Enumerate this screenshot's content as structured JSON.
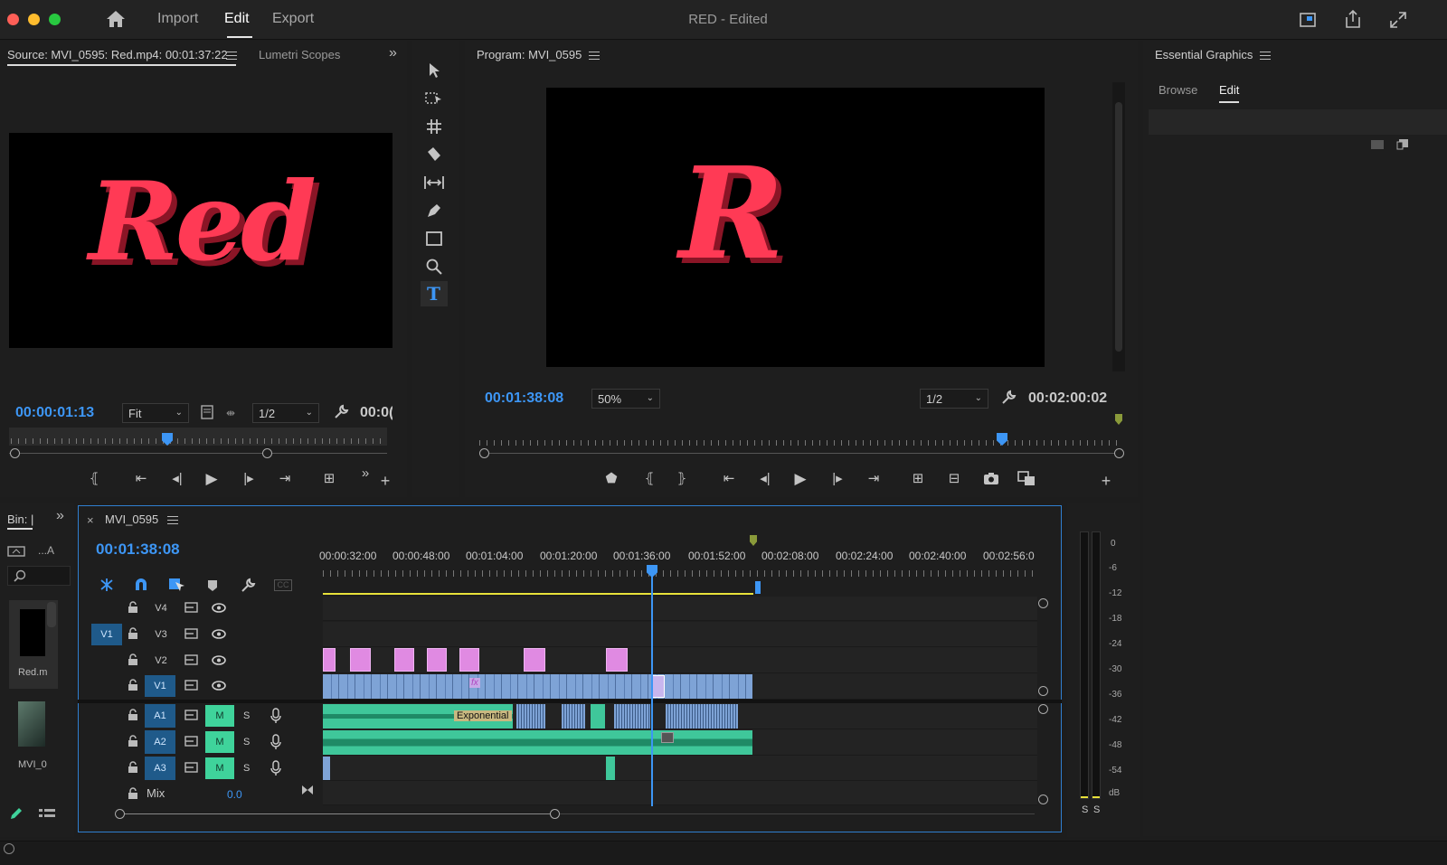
{
  "app": {
    "title": "RED - Edited",
    "workspaces": [
      "Import",
      "Edit",
      "Export"
    ],
    "active_workspace": "Edit"
  },
  "source_panel": {
    "tab_title": "Source: MVI_0595: Red.mp4: 00:01:37:22",
    "other_tab": "Lumetri Scopes",
    "preview_text": "Red",
    "timecode": "00:00:01:13",
    "fit": "Fit",
    "resolution": "1/2",
    "duration_partial": "00:0("
  },
  "program_panel": {
    "title": "Program: MVI_0595",
    "preview_text": "R",
    "timecode": "00:01:38:08",
    "zoom": "50%",
    "resolution": "1/2",
    "duration": "00:02:00:02"
  },
  "essential_graphics": {
    "title": "Essential Graphics",
    "tabs": [
      "Browse",
      "Edit"
    ],
    "active_tab": "Edit"
  },
  "project_panel": {
    "tab": "Bin: |",
    "label_a": "...A",
    "items": [
      "Red.m",
      "MVI_0"
    ]
  },
  "timeline": {
    "sequence_name": "MVI_0595",
    "timecode": "00:01:38:08",
    "ruler_labels": [
      "00:00:32:00",
      "00:00:48:00",
      "00:01:04:00",
      "00:01:20:00",
      "00:01:36:00",
      "00:01:52:00",
      "00:02:08:00",
      "00:02:24:00",
      "00:02:40:00",
      "00:02:56:0"
    ],
    "video_tracks": [
      "V4",
      "V3",
      "V2",
      "V1"
    ],
    "source_patch": "V1",
    "audio_tracks": [
      "A1",
      "A2",
      "A3"
    ],
    "mute_label": "M",
    "solo_label": "S",
    "mix_label": "Mix",
    "mix_value": "0.0",
    "clip_label_exponential": "Exponential",
    "fx_label": "fx"
  },
  "audio_meter": {
    "scale": [
      "0",
      "-6",
      "-12",
      "-18",
      "-24",
      "-30",
      "-36",
      "-42",
      "-48",
      "-54",
      "dB"
    ],
    "solo": [
      "S",
      "S"
    ]
  },
  "colors": {
    "accent_blue": "#3d96f5",
    "clip_video": "#7ea3d6",
    "clip_graphic": "#e08ae2",
    "clip_audio": "#3fd39b",
    "text_red": "#ff3a55",
    "work_area_yellow": "#e8e13a"
  }
}
